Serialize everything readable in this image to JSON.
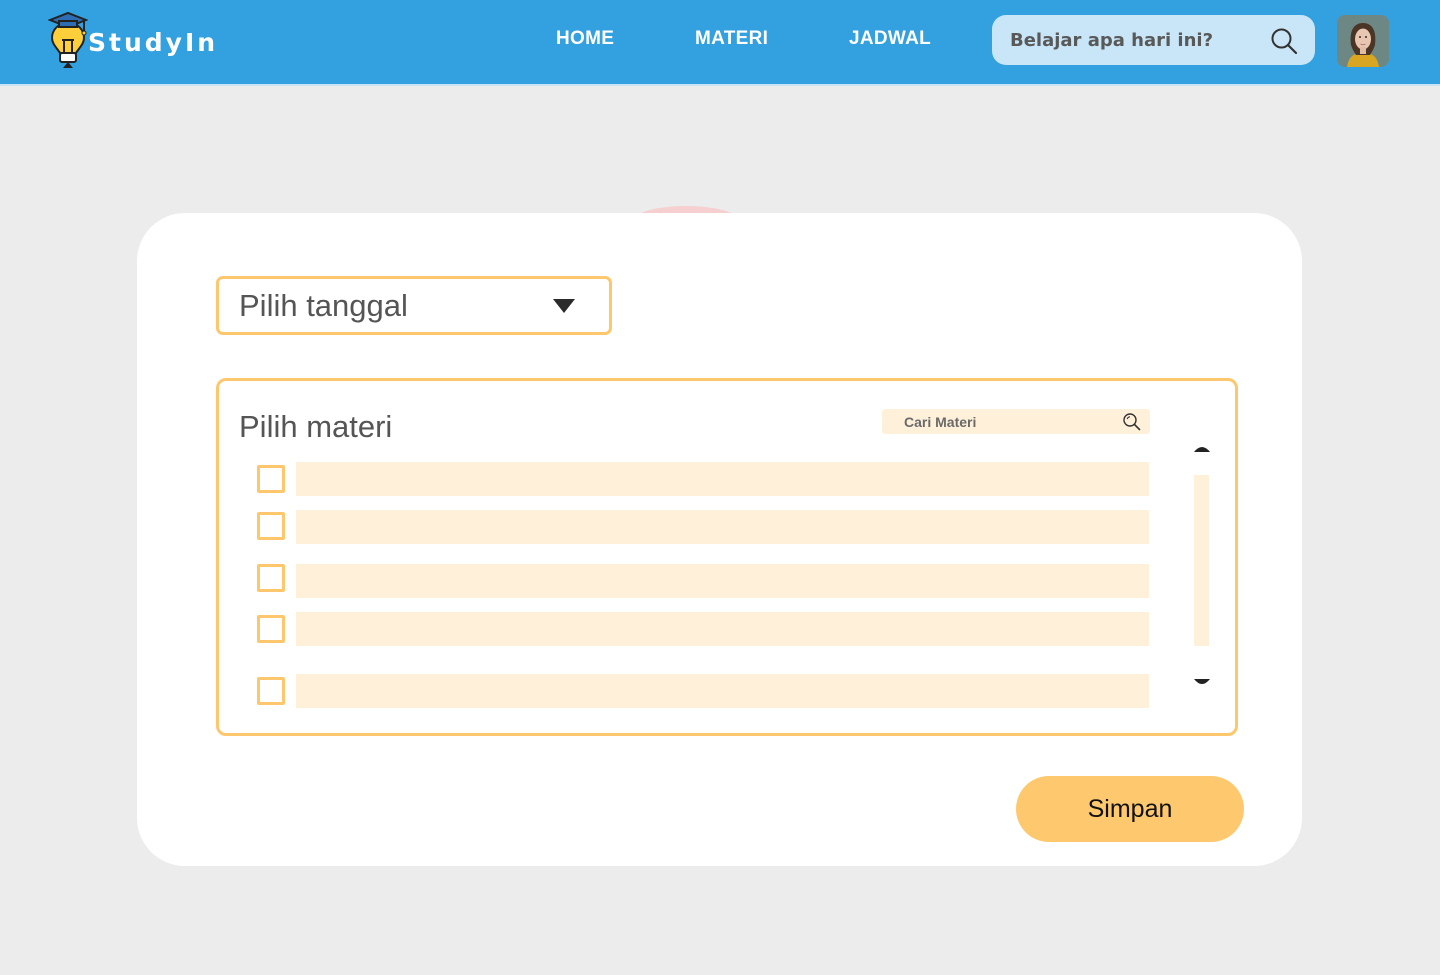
{
  "app": {
    "brand": "StudyIn"
  },
  "nav": {
    "items": [
      {
        "label": "HOME"
      },
      {
        "label": "MATERI"
      },
      {
        "label": "JADWAL"
      }
    ]
  },
  "search": {
    "placeholder": "Belajar apa hari ini?",
    "value": "",
    "icon": "search-icon"
  },
  "user": {
    "avatar": "user-avatar"
  },
  "form": {
    "date_select": {
      "label": "Pilih tanggal",
      "icon": "chevron-down-icon"
    },
    "materi": {
      "title": "Pilih materi",
      "search_placeholder": "Cari Materi",
      "search_value": "",
      "items": [
        {
          "label": "",
          "checked": false
        },
        {
          "label": "",
          "checked": false
        },
        {
          "label": "",
          "checked": false
        },
        {
          "label": "",
          "checked": false
        },
        {
          "label": "",
          "checked": false
        }
      ]
    },
    "save_label": "Simpan"
  },
  "colors": {
    "header": "#33a0df",
    "accent": "#fec76e",
    "item_fill": "#fff1d9",
    "background": "#ececec",
    "card": "#ffffff"
  }
}
